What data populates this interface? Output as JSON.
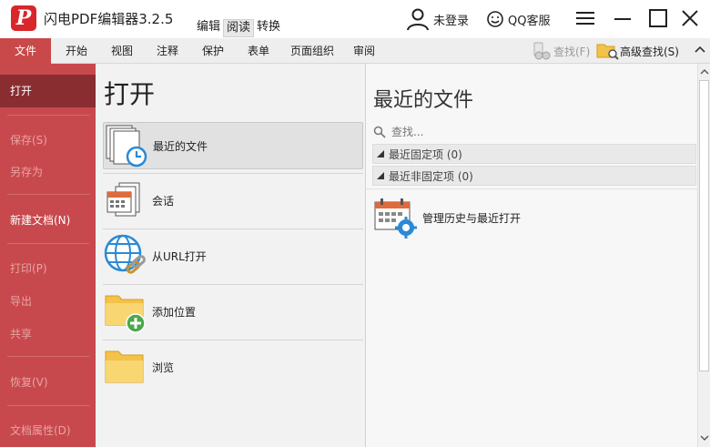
{
  "app": {
    "logo_letter": "P",
    "title": "闪电PDF编辑器3.2.5",
    "mode_tabs": [
      "编辑",
      "阅读",
      "转换"
    ],
    "active_mode": "阅读",
    "user_label": "未登录",
    "qq_label": "QQ客服"
  },
  "ribbon": {
    "tabs": [
      "文件",
      "开始",
      "视图",
      "注释",
      "保护",
      "表单",
      "页面组织",
      "审阅"
    ],
    "active_tab": "文件",
    "search_label": "查找(F)",
    "advanced_search_label": "高级查找(S)"
  },
  "leftnav": {
    "items": [
      {
        "label": "打开",
        "state": "selected"
      },
      {
        "label": "保存(S)",
        "state": "disabled"
      },
      {
        "label": "另存为",
        "state": "disabled"
      },
      {
        "label": "新建文档(N)",
        "state": "normal"
      },
      {
        "label": "打印(P)",
        "state": "disabled"
      },
      {
        "label": "导出",
        "state": "disabled"
      },
      {
        "label": "共享",
        "state": "disabled"
      },
      {
        "label": "恢复(V)",
        "state": "disabled"
      },
      {
        "label": "文档属性(D)",
        "state": "disabled"
      }
    ]
  },
  "open_panel": {
    "title": "打开",
    "items": [
      {
        "label": "最近的文件",
        "icon": "recent-files-icon",
        "selected": true
      },
      {
        "label": "会话",
        "icon": "session-icon",
        "selected": false
      },
      {
        "label": "从URL打开",
        "icon": "globe-link-icon",
        "selected": false
      },
      {
        "label": "添加位置",
        "icon": "add-folder-icon",
        "selected": false
      },
      {
        "label": "浏览",
        "icon": "folder-icon",
        "selected": false
      }
    ]
  },
  "recent_panel": {
    "title": "最近的文件",
    "search_placeholder": "查找...",
    "pinned_group": "最近固定项 (0)",
    "unpinned_group": "最近非固定项 (0)",
    "history_label": "管理历史与最近打开"
  },
  "colors": {
    "accent": "#c8494d",
    "nav_selected": "#8a2d31",
    "logo_red": "#d8262b"
  }
}
